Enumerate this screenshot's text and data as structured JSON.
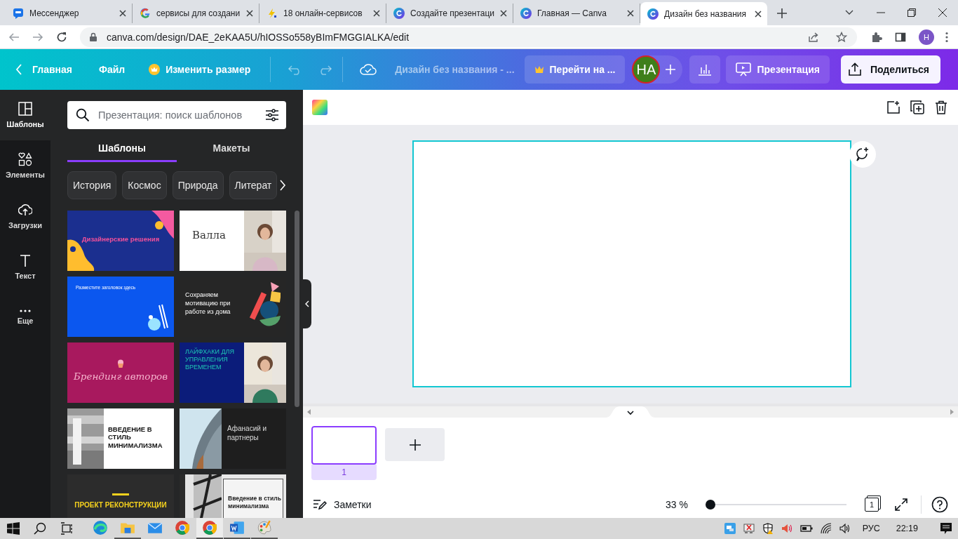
{
  "browser": {
    "tabs": [
      {
        "kind": "messenger",
        "title": "Мессенджер",
        "selected": false
      },
      {
        "kind": "google",
        "title": "сервисы для создани",
        "selected": false
      },
      {
        "kind": "bolt",
        "title": "18 онлайн-сервисов",
        "selected": false
      },
      {
        "kind": "canva",
        "title": "Создайте презентаци",
        "selected": false
      },
      {
        "kind": "canva",
        "title": "Главная — Canva",
        "selected": false
      },
      {
        "kind": "canva",
        "title": "Дизайн без названия",
        "selected": true
      }
    ],
    "address": "canva.com/design/DAE_2eKAA5U/hIOSSo558yBImFMGGIALKA/edit",
    "profile": "Н"
  },
  "toolbar": {
    "home": "Главная",
    "file": "Файл",
    "resize": "Изменить размер",
    "title": "Дизайн без названия - ...",
    "upgrade": "Перейти на ...",
    "avatar": "НА",
    "present": "Презентация",
    "share": "Поделиться"
  },
  "sidebar": {
    "items": [
      {
        "kind": "layout",
        "label": "Шаблоны",
        "selected": true
      },
      {
        "kind": "elements",
        "label": "Элементы",
        "selected": false
      },
      {
        "kind": "upload",
        "label": "Загрузки",
        "selected": false
      },
      {
        "kind": "text",
        "label": "Текст",
        "selected": false
      },
      {
        "kind": "more",
        "label": "Еще",
        "selected": false
      }
    ]
  },
  "panel": {
    "search": {
      "placeholder": "Презентация: поиск шаблонов"
    },
    "tabs": [
      {
        "label": "Шаблоны",
        "selected": true
      },
      {
        "label": "Макеты",
        "selected": false
      }
    ],
    "chips": [
      "История",
      "Космос",
      "Природа",
      "Литерат"
    ],
    "templates": [
      {
        "kind": "blobs",
        "title": "Дизайнерские решения"
      },
      {
        "kind": "photo-right",
        "title": "Валла"
      },
      {
        "kind": "blue",
        "title": "Разместите заголовок здесь"
      },
      {
        "kind": "shapes",
        "title": "Сохраняем мотивацию при работе из дома"
      },
      {
        "kind": "pink",
        "title": "Брендинг авторов"
      },
      {
        "kind": "photo-navy",
        "title": "ЛАЙФХАКИ ДЛЯ УПРАВЛЕНИЯ ВРЕМЕНЕМ"
      },
      {
        "kind": "concrete",
        "title": "ВВЕДЕНИЕ В СТИЛЬ МИНИМАЛИЗМА"
      },
      {
        "kind": "tower",
        "title": "Афанасий и партнеры"
      },
      {
        "kind": "dark",
        "title": "ПРОЕКТ РЕКОНСТРУКЦИИ"
      },
      {
        "kind": "grid",
        "title": "Введение в стиль минимализма"
      }
    ]
  },
  "pages": [
    {
      "number": "1",
      "selected": true
    }
  ],
  "footer": {
    "notes": "Заметки",
    "zoom": "33 %",
    "zoom_slider": {
      "level": 0.03
    },
    "page_count": "1"
  },
  "taskbar": {
    "apps": [
      {
        "kind": "edge",
        "running": false,
        "selected": false
      },
      {
        "kind": "explorer",
        "running": true,
        "selected": false
      },
      {
        "kind": "mail",
        "running": false,
        "selected": false
      },
      {
        "kind": "chrome",
        "running": false,
        "selected": false
      },
      {
        "kind": "chrome",
        "running": true,
        "selected": true
      },
      {
        "kind": "word",
        "running": true,
        "selected": false
      },
      {
        "kind": "paint",
        "running": true,
        "selected": false
      }
    ],
    "language": "РУС",
    "time": "22:19"
  }
}
